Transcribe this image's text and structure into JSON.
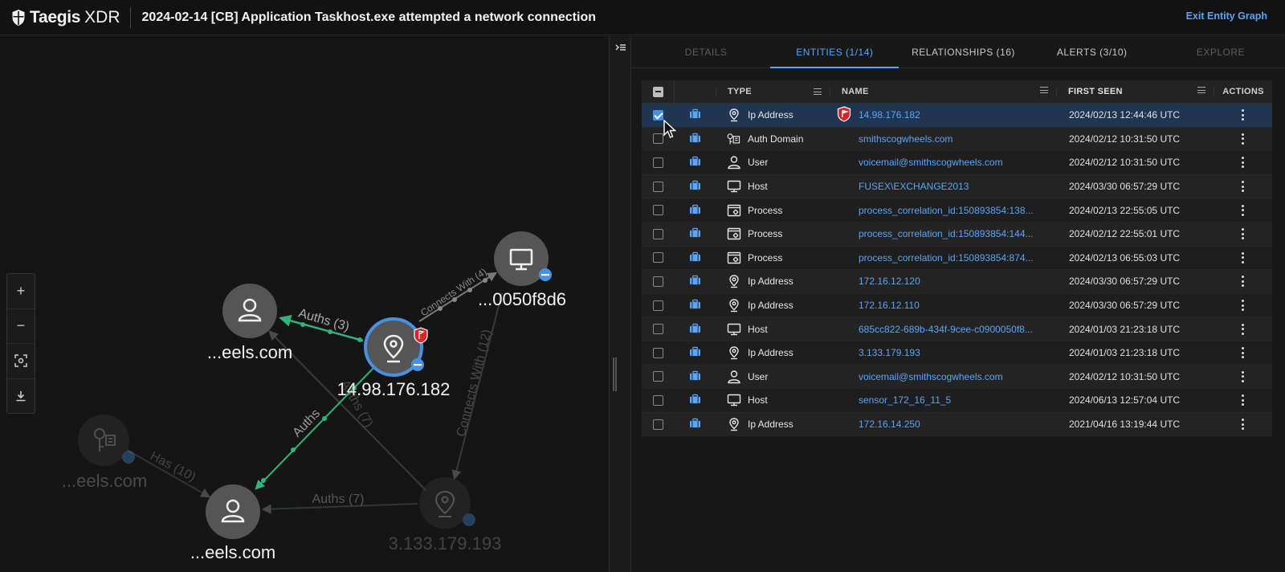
{
  "header": {
    "brand": "Taegis",
    "brand_sub": "XDR",
    "title": "2024-02-14 [CB] Application Taskhost.exe attempted a network connection",
    "exit_link": "Exit Entity Graph"
  },
  "graph": {
    "nodes": {
      "user_top": "...eels.com",
      "ip_center": "14.98.176.182",
      "host": "...0050f8d6",
      "auth_domain": "...eels.com",
      "user_bottom": "...eels.com",
      "ip_faded": "3.133.179.193"
    },
    "edges": {
      "auths_3": "Auths (3)",
      "connects_4": "Connects With (4)",
      "connects_12": "Connects With (12)",
      "auths": "Auths",
      "auths_7_diag": "Auths (7)",
      "auths_7": "Auths (7)",
      "has_10": "Has (10)"
    },
    "zoom": {
      "plus": "+",
      "minus": "−"
    }
  },
  "tabs": [
    {
      "label": "DETAILS",
      "state": "disabled"
    },
    {
      "label": "ENTITIES (1/14)",
      "state": "active"
    },
    {
      "label": "RELATIONSHIPS (16)",
      "state": "normal"
    },
    {
      "label": "ALERTS (3/10)",
      "state": "normal"
    },
    {
      "label": "EXPLORE",
      "state": "disabled"
    }
  ],
  "table": {
    "columns": {
      "type": "TYPE",
      "name": "NAME",
      "first_seen": "FIRST SEEN",
      "actions": "ACTIONS"
    },
    "rows": [
      {
        "type": "Ip Address",
        "icon": "pin",
        "flag": true,
        "name": "14.98.176.182",
        "first_seen": "2024/02/13 12:44:46 UTC",
        "checked": true
      },
      {
        "type": "Auth Domain",
        "icon": "key",
        "flag": false,
        "name": "smithscogwheels.com",
        "first_seen": "2024/02/12 10:31:50 UTC",
        "checked": false
      },
      {
        "type": "User",
        "icon": "user",
        "flag": false,
        "name": "voicemail@smithscogwheels.com",
        "first_seen": "2024/02/12 10:31:50 UTC",
        "checked": false
      },
      {
        "type": "Host",
        "icon": "monitor",
        "flag": false,
        "name": "FUSEX\\EXCHANGE2013",
        "first_seen": "2024/03/30 06:57:29 UTC",
        "checked": false
      },
      {
        "type": "Process",
        "icon": "process",
        "flag": false,
        "name": "process_correlation_id:150893854:138...",
        "first_seen": "2024/02/13 22:55:05 UTC",
        "checked": false
      },
      {
        "type": "Process",
        "icon": "process",
        "flag": false,
        "name": "process_correlation_id:150893854:144...",
        "first_seen": "2024/02/12 22:55:01 UTC",
        "checked": false
      },
      {
        "type": "Process",
        "icon": "process",
        "flag": false,
        "name": "process_correlation_id:150893854:874...",
        "first_seen": "2024/02/13 06:55:03 UTC",
        "checked": false
      },
      {
        "type": "Ip Address",
        "icon": "pin",
        "flag": false,
        "name": "172.16.12.120",
        "first_seen": "2024/03/30 06:57:29 UTC",
        "checked": false
      },
      {
        "type": "Ip Address",
        "icon": "pin",
        "flag": false,
        "name": "172.16.12.110",
        "first_seen": "2024/03/30 06:57:29 UTC",
        "checked": false
      },
      {
        "type": "Host",
        "icon": "monitor",
        "flag": false,
        "name": "685cc822-689b-434f-9cee-c0900050f8...",
        "first_seen": "2024/01/03 21:23:18 UTC",
        "checked": false
      },
      {
        "type": "Ip Address",
        "icon": "pin",
        "flag": false,
        "name": "3.133.179.193",
        "first_seen": "2024/01/03 21:23:18 UTC",
        "checked": false
      },
      {
        "type": "User",
        "icon": "user",
        "flag": false,
        "name": "voicemail@smithscogwheels.com",
        "first_seen": "2024/02/12 10:31:50 UTC",
        "checked": false
      },
      {
        "type": "Host",
        "icon": "monitor",
        "flag": false,
        "name": "sensor_172_16_11_5",
        "first_seen": "2024/06/13 12:57:04 UTC",
        "checked": false
      },
      {
        "type": "Ip Address",
        "icon": "pin",
        "flag": false,
        "name": "172.16.14.250",
        "first_seen": "2021/04/16 13:19:44 UTC",
        "checked": false
      }
    ]
  },
  "colors": {
    "accent": "#5aa5f5",
    "edge_green": "#2fb37a",
    "flag_red": "#d7262b"
  }
}
